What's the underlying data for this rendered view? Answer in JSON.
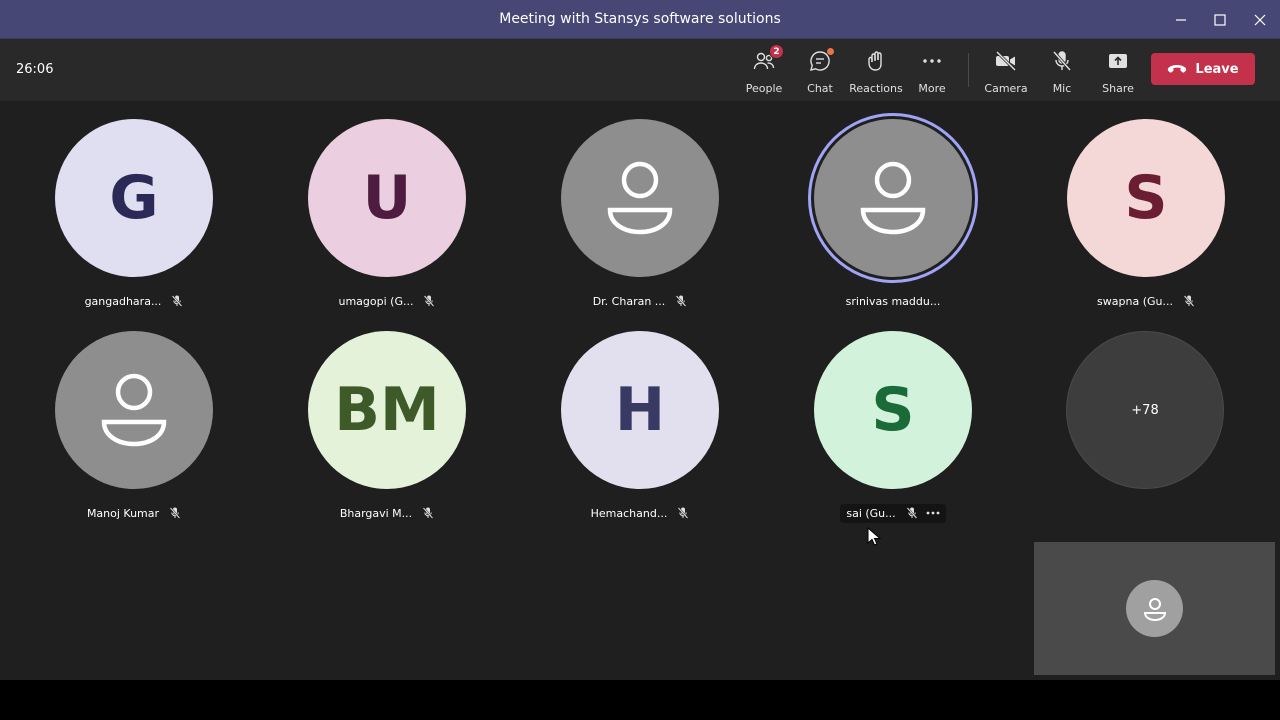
{
  "window": {
    "title": "Meeting with Stansys software solutions"
  },
  "toolbar": {
    "timer": "26:06",
    "people": {
      "label": "People",
      "badge": "2"
    },
    "chat": {
      "label": "Chat"
    },
    "reactions": {
      "label": "Reactions"
    },
    "more": {
      "label": "More"
    },
    "camera": {
      "label": "Camera"
    },
    "mic": {
      "label": "Mic"
    },
    "share": {
      "label": "Share"
    },
    "leave": {
      "label": "Leave"
    }
  },
  "participants": [
    {
      "name": "gangadhara...",
      "initials": "G",
      "bg": "#e0def1",
      "fg": "#2b2a57",
      "muted": true
    },
    {
      "name": "umagopi (G...",
      "initials": "U",
      "bg": "#ebcfe0",
      "fg": "#4d1c3f",
      "muted": true
    },
    {
      "name": "Dr. Charan ...",
      "initials": "",
      "bg": "#8e8e8e",
      "fg": "#ffffff",
      "muted": true
    },
    {
      "name": "srinivas maddu...",
      "initials": "",
      "bg": "#8e8e8e",
      "fg": "#ffffff",
      "muted": false
    },
    {
      "name": "swapna (Gu...",
      "initials": "S",
      "bg": "#f4d8d8",
      "fg": "#6b1e32",
      "muted": true
    },
    {
      "name": "Manoj Kumar",
      "initials": "",
      "bg": "#8e8e8e",
      "fg": "#ffffff",
      "muted": true
    },
    {
      "name": "Bhargavi M...",
      "initials": "BM",
      "bg": "#e4f2d9",
      "fg": "#3d5a28",
      "muted": true
    },
    {
      "name": "Hemachand...",
      "initials": "H",
      "bg": "#e2dfef",
      "fg": "#393a64",
      "muted": true
    },
    {
      "name": "sai (Gu...",
      "initials": "S",
      "bg": "#d2f2dc",
      "fg": "#1a6b37",
      "muted": true
    }
  ],
  "overflow": {
    "label": "+78"
  },
  "colors": {
    "titlebar": "#464775",
    "toolbar": "#292929",
    "stage": "#1f1f1f",
    "leave": "#c4314b",
    "speaking_ring": "#a1a3f7"
  }
}
